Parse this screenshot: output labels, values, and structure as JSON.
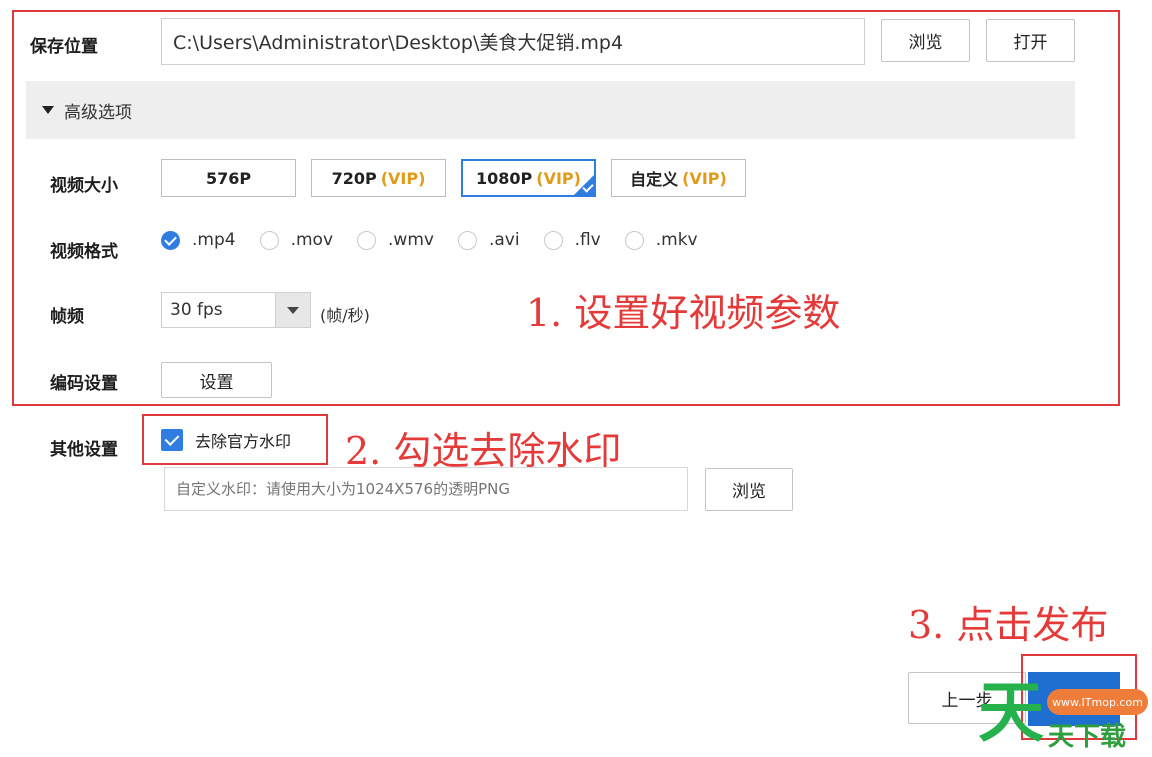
{
  "save": {
    "label": "保存位置",
    "path_value": "C:\\Users\\Administrator\\Desktop\\美食大促销.mp4",
    "browse_label": "浏览",
    "open_label": "打开"
  },
  "advanced": {
    "header_label": "高级选项",
    "size_label": "视频大小",
    "sizes": [
      {
        "name": "576P",
        "vip": ""
      },
      {
        "name": "720P",
        "vip": "(VIP)"
      },
      {
        "name": "1080P",
        "vip": "(VIP)"
      },
      {
        "name": "自定义",
        "vip": "(VIP)"
      }
    ],
    "selected_size": "1080P",
    "format_label": "视频格式",
    "formats": [
      ".mp4",
      ".mov",
      ".wmv",
      ".avi",
      ".flv",
      ".mkv"
    ],
    "selected_format": ".mp4",
    "fps_label": "帧频",
    "fps_value": "30 fps",
    "fps_unit": "(帧/秒)",
    "encoding_label": "编码设置",
    "encoding_button": "设置"
  },
  "other": {
    "label": "其他设置",
    "remove_watermark_label": "去除官方水印",
    "remove_watermark_checked": true,
    "custom_watermark_placeholder": "自定义水印：请使用大小为1024X576的透明PNG",
    "browse_label": "浏览"
  },
  "nav": {
    "prev_label": "上一步"
  },
  "annotations": {
    "step1": "1. 设置好视频参数",
    "step2": "2. 勾选去除水印",
    "step3": "3. 点击发布"
  },
  "watermark": {
    "url_text": "www.ITmop.com",
    "glyph": "天",
    "text": "天下载"
  },
  "colors": {
    "accent": "#2f7de1",
    "vip": "#e09b1a",
    "annotation_red": "#e43a3a",
    "publish_blue": "#1f6fd1"
  }
}
